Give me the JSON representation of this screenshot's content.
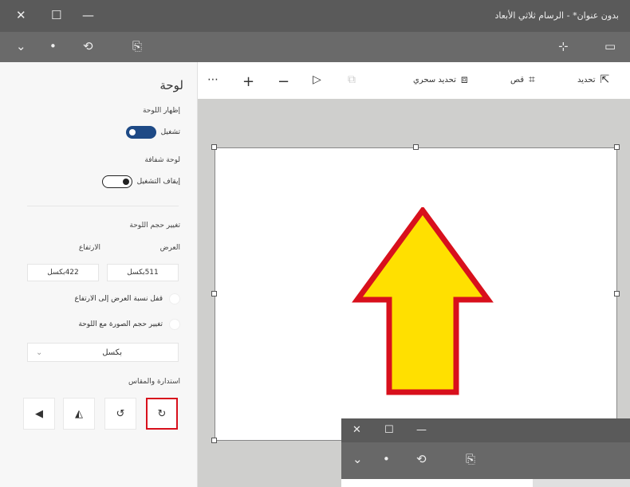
{
  "window": {
    "title": "بدون عنوان* - الرسام ثلاثي الأبعاد",
    "close_glyph": "✕",
    "maximize_glyph": "☐",
    "minimize_glyph": "—"
  },
  "toolbar1": {
    "menu_glyph": "⌄",
    "dot_glyph": "•",
    "undo_glyph": "⟲",
    "paste_glyph": "⎘",
    "right_a_glyph": "⊹",
    "right_b_glyph": "▭"
  },
  "cmdbar": {
    "more_glyph": "⋯",
    "zoom_in_glyph": "+",
    "zoom_out_glyph": "−",
    "lasso_glyph": "▷",
    "copy_glyph": "⧉",
    "magic_select": {
      "label": "تحديد سحري",
      "icon": "magic-select-icon",
      "glyph": "⧈"
    },
    "crop": {
      "label": "قص",
      "icon": "crop-icon",
      "glyph": "⌗"
    },
    "select": {
      "label": "تحديد",
      "icon": "cursor-icon",
      "glyph": "⇱"
    }
  },
  "panel": {
    "title": "لوحة",
    "show_canvas_label": "إظهار اللوحة",
    "show_canvas_state": "تشغيل",
    "transparent_label": "لوحة شفافة",
    "transparent_state": "إيقاف التشغيل",
    "resize_label": "تغيير حجم اللوحة",
    "width_label": "العرض",
    "height_label": "الارتفاع",
    "width_value": "511بكسل",
    "height_value": "422بكسل",
    "lock_ratio_label": "قفل نسبة العرض إلى الارتفاع",
    "resize_image_label": "تغيير حجم الصورة مع اللوحة",
    "unit_value": "بكسل",
    "unit_chevron": "⌄",
    "rotate_label": "استدارة والمقاس",
    "rotate_buttons": [
      "↻",
      "↺",
      "◭",
      "◀"
    ]
  },
  "colors": {
    "arrow_fill": "#ffe000",
    "arrow_stroke": "#d8101c",
    "toggle_on": "#1e4a86",
    "highlight": "#d8101c"
  },
  "window2": {
    "close_glyph": "✕",
    "maximize_glyph": "☐",
    "minimize_glyph": "—",
    "menu_glyph": "⌄",
    "dot_glyph": "•",
    "undo_glyph": "⟲",
    "paste_glyph": "⎘"
  }
}
